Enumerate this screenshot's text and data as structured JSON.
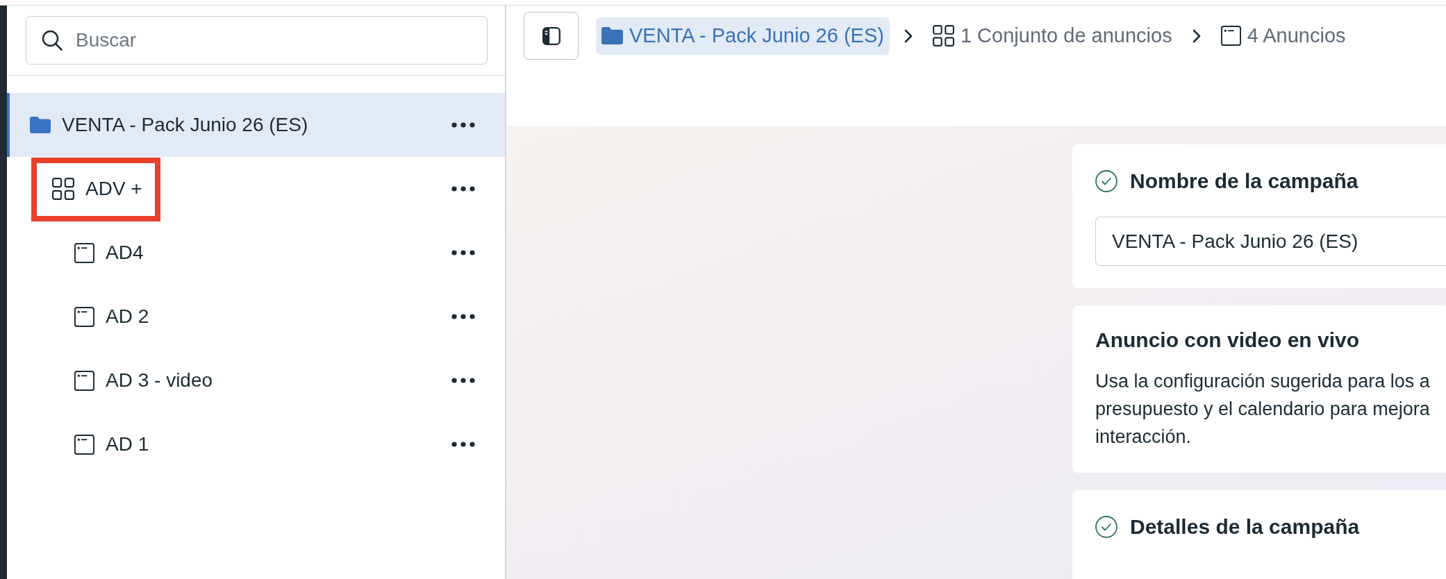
{
  "sidebar": {
    "search": {
      "placeholder": "Buscar"
    },
    "tree": [
      {
        "kind": "campaign",
        "label": "VENTA - Pack Junio 26 (ES)",
        "selected": true,
        "highlighted": false,
        "children": [
          {
            "kind": "ad_set",
            "label": "ADV +",
            "selected": false,
            "highlighted": true,
            "children": [
              {
                "kind": "ad",
                "label": "AD4",
                "selected": false,
                "highlighted": false
              },
              {
                "kind": "ad",
                "label": "AD 2",
                "selected": false,
                "highlighted": false
              },
              {
                "kind": "ad",
                "label": "AD 3 - video",
                "selected": false,
                "highlighted": false
              },
              {
                "kind": "ad",
                "label": "AD 1",
                "selected": false,
                "highlighted": false
              }
            ]
          }
        ]
      }
    ]
  },
  "toolbar": {
    "breadcrumbs": [
      {
        "kind": "campaign",
        "label": "VENTA - Pack Junio 26 (ES)",
        "selected": true
      },
      {
        "kind": "ad_set",
        "label": "1 Conjunto de anuncios",
        "selected": false
      },
      {
        "kind": "ad",
        "label": "4 Anuncios",
        "selected": false
      }
    ]
  },
  "cards": [
    {
      "kind": "field",
      "title": "Nombre de la campaña",
      "complete": true,
      "value": "VENTA - Pack Junio 26 (ES)"
    },
    {
      "kind": "info",
      "title": "Anuncio con video en vivo",
      "complete": false,
      "description_lines": [
        "Usa la configuración sugerida para los a",
        "presupuesto y el calendario para mejora",
        "interacción."
      ]
    },
    {
      "kind": "section",
      "title": "Detalles de la campaña",
      "complete": true
    }
  ]
}
